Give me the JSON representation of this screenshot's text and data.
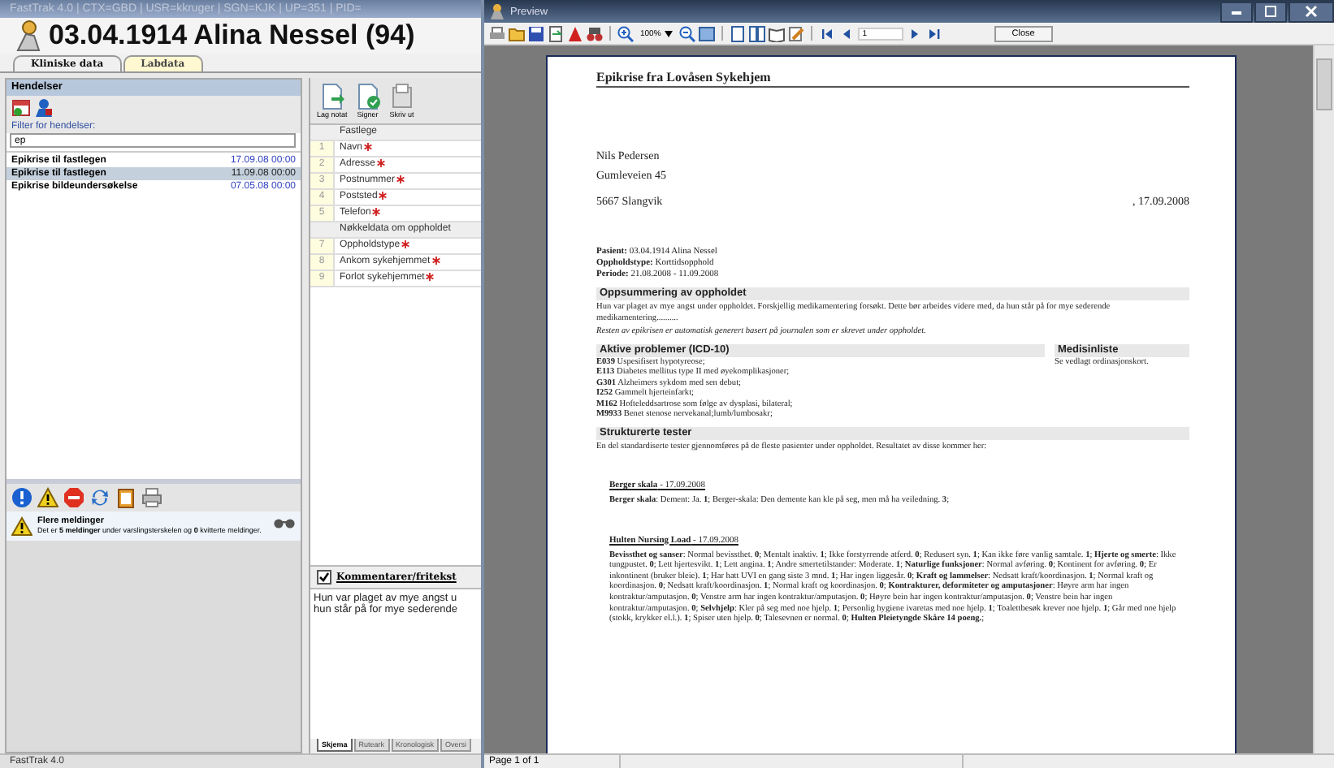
{
  "app": {
    "title": "FastTrak 4.0 | CTX=GBD | USR=kkruger | SGN=KJK | UP=351 | PID=",
    "patient_header": "03.04.1914 Alina Nessel (94)",
    "tabs": [
      {
        "label": "Kliniske data",
        "selected": true
      },
      {
        "label": "Labdata",
        "selected": false
      }
    ],
    "events": {
      "title": "Hendelser",
      "filter_label": "Filter for hendelser:",
      "filter_value": "ep",
      "rows": [
        {
          "name": "Epikrise til fastlegen",
          "date": "17.09.08 00:00",
          "selected": false
        },
        {
          "name": "Epikrise til fastlegen",
          "date": "11.09.08 00:00",
          "selected": true
        },
        {
          "name": "Epikrise bildeundersøkelse",
          "date": "07.05.08 00:00",
          "selected": false
        }
      ]
    },
    "message": {
      "title": "Flere meldinger",
      "text": "Det er **5 meldinger** under varslingsterskelen og **0** kvitterte meldinger."
    },
    "form_toolbar": [
      "Lag notat",
      "Signer",
      "Skriv ut"
    ],
    "form_rows": [
      {
        "kind": "section",
        "label": "Fastlege"
      },
      {
        "kind": "field",
        "number": "1",
        "label": "Navn",
        "required": true
      },
      {
        "kind": "field",
        "number": "2",
        "label": "Adresse",
        "required": true
      },
      {
        "kind": "field",
        "number": "3",
        "label": "Postnummer",
        "required": true
      },
      {
        "kind": "field",
        "number": "4",
        "label": "Poststed",
        "required": true
      },
      {
        "kind": "field",
        "number": "5",
        "label": "Telefon",
        "required": true
      },
      {
        "kind": "section",
        "label": "Nøkkeldata om oppholdet"
      },
      {
        "kind": "field",
        "number": "7",
        "label": "Oppholdstype",
        "required": true
      },
      {
        "kind": "field",
        "number": "8",
        "label": "Ankom sykehjemmet",
        "required": true
      },
      {
        "kind": "field",
        "number": "9",
        "label": "Forlot sykehjemmet",
        "required": true
      }
    ],
    "comments": {
      "label": "Kommentarer/fritekst",
      "checked": true,
      "lines": [
        "Hun var plaget av mye angst u",
        "hun står på for mye sederende"
      ]
    },
    "bottom_tabs": [
      {
        "label": "Skjema",
        "selected": true
      },
      {
        "label": "Ruteark",
        "selected": false
      },
      {
        "label": "Kronologisk",
        "selected": false
      },
      {
        "label": "Oversi",
        "selected": false
      }
    ],
    "status": "FastTrak 4.0"
  },
  "preview": {
    "title": "Preview",
    "zoom": "100%",
    "page_field": "1",
    "close_button": "Close",
    "document": {
      "title": "Epikrise fra Lovåsen Sykehjem",
      "address": [
        "Nils Pedersen",
        "Gumleveien 45"
      ],
      "city": "5667 Slangvik",
      "date": ", 17.09.2008",
      "patient_info": [
        "**Pasient:** 03.04.1914 Alina Nessel",
        "**Oppholdstype:** Korttidsopphold",
        "**Periode:** 21.08.2008 - 11.09.2008"
      ],
      "summary": {
        "heading": "Oppsummering av oppholdet",
        "paragraphs": [
          {
            "kind": "plain",
            "text": "Hun var plaget av mye angst under oppholdet. Forskjellig medikamentering forsøkt. Dette bør arbeides videre med, da hun står på for mye sederende medikamentering.........."
          },
          {
            "kind": "italic",
            "text": "Resten av epikrisen er automatisk generert basert på journalen som er skrevet under oppholdet."
          }
        ]
      },
      "problems": {
        "heading": "Aktive problemer (ICD-10)",
        "lines": [
          "**E039** Uspesifisert hypotyreose;",
          "**E113** Diabetes mellitus type II med øyekomplikasjoner;",
          "**G301** Alzheimers sykdom med sen debut;",
          "**I252** Gammelt hjerteinfarkt;",
          "**M162** Hofteleddsartrose som følge av dysplasi, bilateral;",
          "**M9933** Benet stenose nervekanal;lumb/lumbosakr;"
        ]
      },
      "medications": {
        "heading": "Medisinliste",
        "text": "Se vedlagt ordinasjonskort."
      },
      "tests": {
        "heading": "Strukturerte tester",
        "intro": "En del standardiserte tester gjennomføres på de fleste pasienter under oppholdet.  Resultatet av disse kommer her:",
        "items": [
          {
            "heading": "**Berger skala** - 17.09.2008",
            "body": "**Berger skala**: Dement: Ja. **1**; Berger-skala: Den demente kan kle på seg, men må ha veiledning. **3**;"
          },
          {
            "heading": "**Hulten Nursing Load** - 17.09.2008",
            "body": "**Bevissthet og sanser**: Normal bevissthet. **0**; Mentalt inaktiv. **1**; Ikke forstyrrende atferd. **0**; Redusert syn. **1**; Kan ikke føre vanlig samtale. **1**; **Hjerte og smerte**: Ikke tungpustet. **0**; Lett hjertesvikt. **1**; Lett angina. **1**; Andre smertetilstander: Moderate. **1**; **Naturlige funksjoner**: Normal avføring. **0**; Kontinent for avføring. **0**; Er inkontinent (bruker bleie). **1**; Har hatt UVI en gang siste 3 mnd. **1**; Har ingen liggesår. **0**; **Kraft og lammelser**: Nedsatt kraft/koordinasjon. **1**; Normal kraft og koordinasjon. **0**; Nedsatt kraft/koordinasjon. **1**; Normal kraft og koordinasjon. **0**; **Kontrakturer, deformiteter og amputasjoner**: Høyre arm har ingen kontraktur/amputasjon. **0**; Venstre arm har ingen kontraktur/amputasjon. **0**; Høyre bein har ingen kontraktur/amputasjon. **0**; Venstre bein har ingen kontraktur/amputasjon. **0**; **Selvhjelp**: Kler på seg med noe hjelp. **1**; Personlig hygiene ivaretas med noe hjelp. **1**; Toalettbesøk krever noe hjelp. **1**; Går med noe hjelp (stokk, krykker el.l.). **1**; Spiser uten hjelp. **0**; Talesevnen er normal. **0**; **Hulten Pleietyngde Skåre 14 poeng.**;"
          }
        ]
      }
    },
    "status": "Page 1 of 1"
  }
}
